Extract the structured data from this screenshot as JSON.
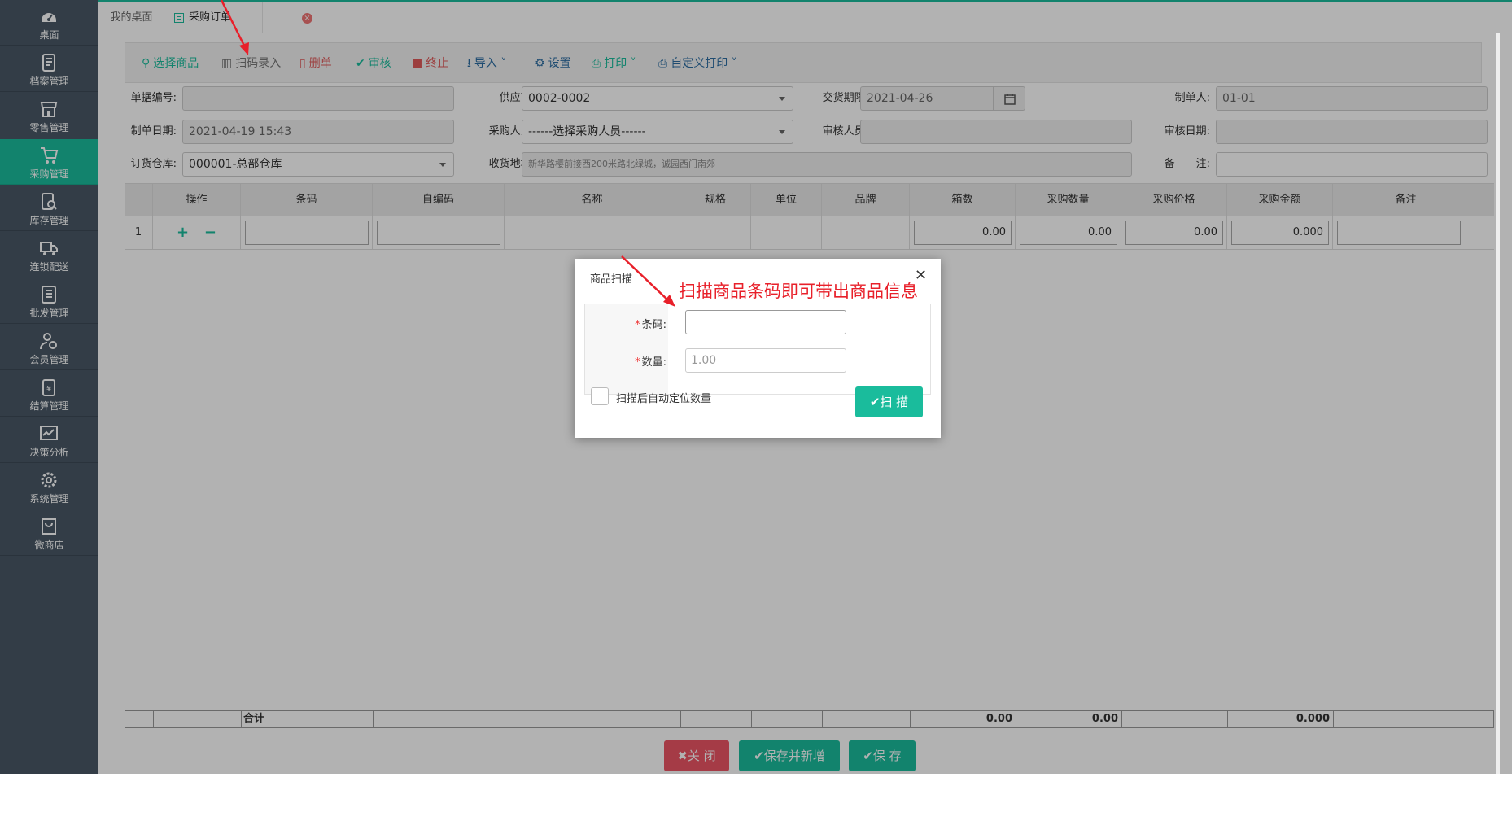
{
  "sidebar": {
    "items": [
      {
        "label": "桌面",
        "icon": "dashboard-icon"
      },
      {
        "label": "档案管理",
        "icon": "archive-icon"
      },
      {
        "label": "零售管理",
        "icon": "store-icon"
      },
      {
        "label": "采购管理",
        "icon": "purchase-icon",
        "active": true
      },
      {
        "label": "库存管理",
        "icon": "inventory-icon"
      },
      {
        "label": "连锁配送",
        "icon": "truck-icon"
      },
      {
        "label": "批发管理",
        "icon": "wholesale-icon"
      },
      {
        "label": "会员管理",
        "icon": "member-icon"
      },
      {
        "label": "结算管理",
        "icon": "settlement-icon"
      },
      {
        "label": "决策分析",
        "icon": "analytics-icon"
      },
      {
        "label": "系统管理",
        "icon": "gear-icon"
      },
      {
        "label": "微商店",
        "icon": "shop-bag-icon"
      }
    ]
  },
  "tabs": {
    "desk": "我的桌面",
    "order": "采购订单"
  },
  "toolbar": {
    "select_goods": "选择商品",
    "scan_entry": "扫码录入",
    "delete": "删单",
    "audit": "审核",
    "stop": "终止",
    "import": "导入",
    "settings": "设置",
    "print": "打印",
    "custom_print": "自定义打印"
  },
  "form": {
    "doc_no_label": "单据编号:",
    "doc_no": "",
    "supplier_label": "供应商:",
    "supplier": "0002-0002",
    "delivery_label": "交货期限:",
    "delivery": "2021-04-26",
    "maker_label": "制单人:",
    "maker": "01-01",
    "make_date_label": "制单日期:",
    "make_date": "2021-04-19 15:43",
    "buyer_label": "采购人员:",
    "buyer": "------选择采购人员------",
    "auditor_label": "审核人员:",
    "auditor": "",
    "audit_date_label": "审核日期:",
    "audit_date": "",
    "warehouse_label": "订货仓库:",
    "warehouse": "000001-总部仓库",
    "address_label": "收货地址:",
    "address": "新华路樱前接西200米路北绿城，诚园西门南郊",
    "remark_label": "备　　注:",
    "remark": ""
  },
  "grid": {
    "columns": [
      "操作",
      "条码",
      "自编码",
      "名称",
      "规格",
      "单位",
      "品牌",
      "箱数",
      "采购数量",
      "采购价格",
      "采购金额",
      "备注"
    ],
    "rows": [
      {
        "no": "1",
        "add": "+",
        "remove": "−",
        "boxes": "0.00",
        "qty": "0.00",
        "price": "0.00",
        "amount": "0.000"
      }
    ],
    "total_label": "合计",
    "total_boxes": "0.00",
    "total_qty": "0.00",
    "total_amount": "0.000"
  },
  "buttons": {
    "close": "关 闭",
    "save_new": "保存并新增",
    "save": "保 存"
  },
  "modal": {
    "title": "商品扫描",
    "barcode_label": "条码:",
    "barcode_value": "",
    "qty_label": "数量:",
    "qty_value": "1.00",
    "auto_locate_label": "扫描后自动定位数量",
    "scan_button": "扫 描"
  },
  "annotation": {
    "text": "扫描商品条码即可带出商品信息",
    "color": "#e8202a"
  },
  "colors": {
    "accent": "#1abc9c",
    "sidebar": "#495866",
    "danger": "#ed5565"
  }
}
